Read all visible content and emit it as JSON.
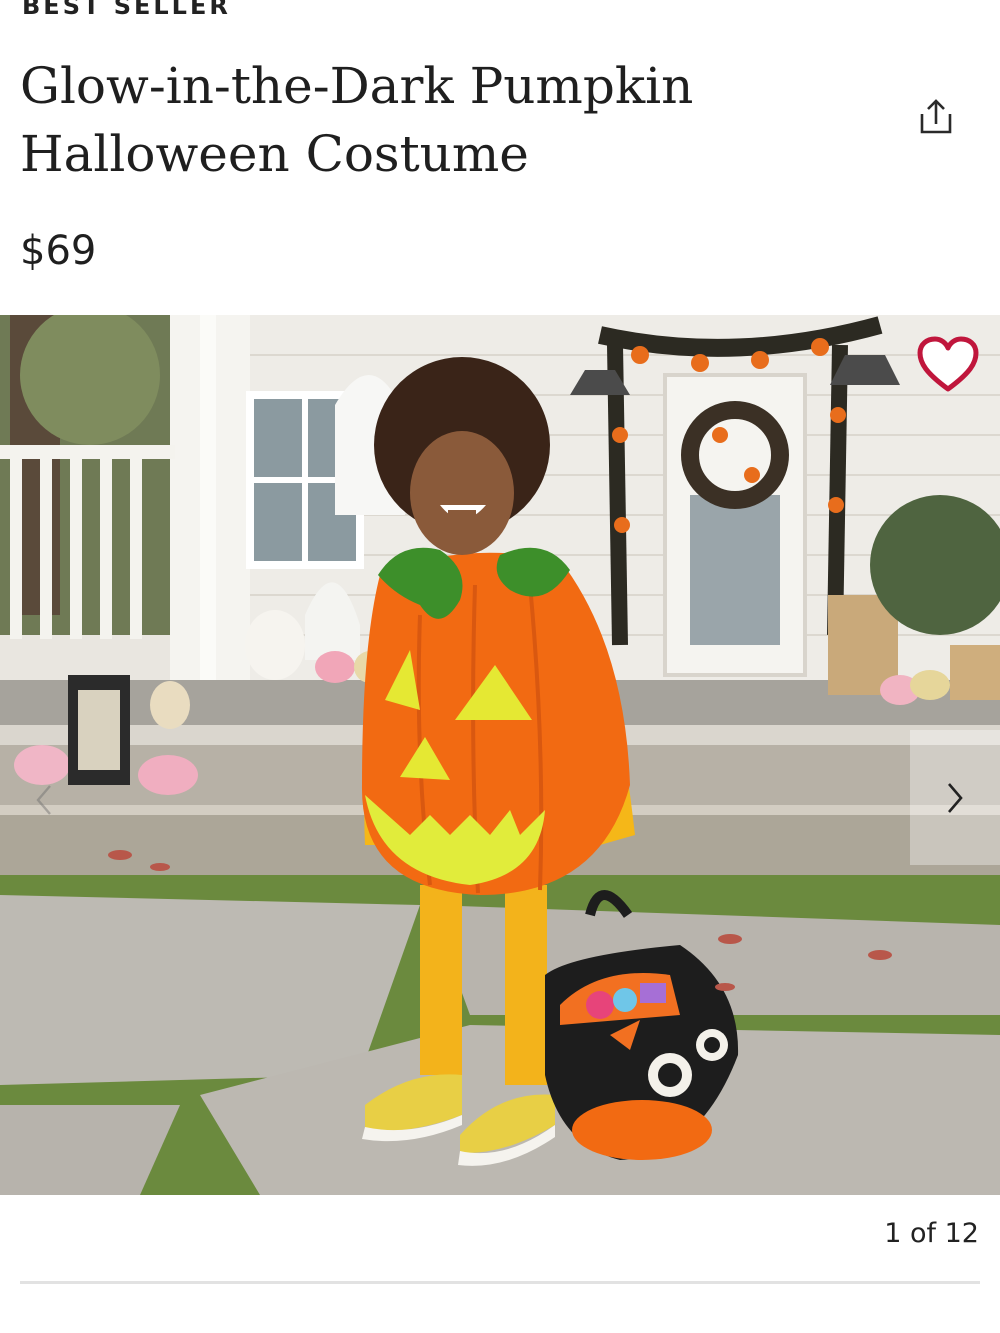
{
  "product": {
    "badge": "BEST SELLER",
    "title": "Glow-in-the-Dark Pumpkin Halloween Costume",
    "price": "$69",
    "image_alt": "Child wearing an orange pumpkin costume holding a black cat treat bucket on a decorated porch"
  },
  "gallery": {
    "counter": "1 of 12",
    "current": 1,
    "total": 12
  },
  "icons": {
    "share": "share-icon",
    "favorite": "heart-icon",
    "prev": "chevron-left-icon",
    "next": "chevron-right-icon"
  },
  "colors": {
    "heart": "#c0163c",
    "pumpkin": "#f26a12",
    "text": "#1f1f1f"
  }
}
